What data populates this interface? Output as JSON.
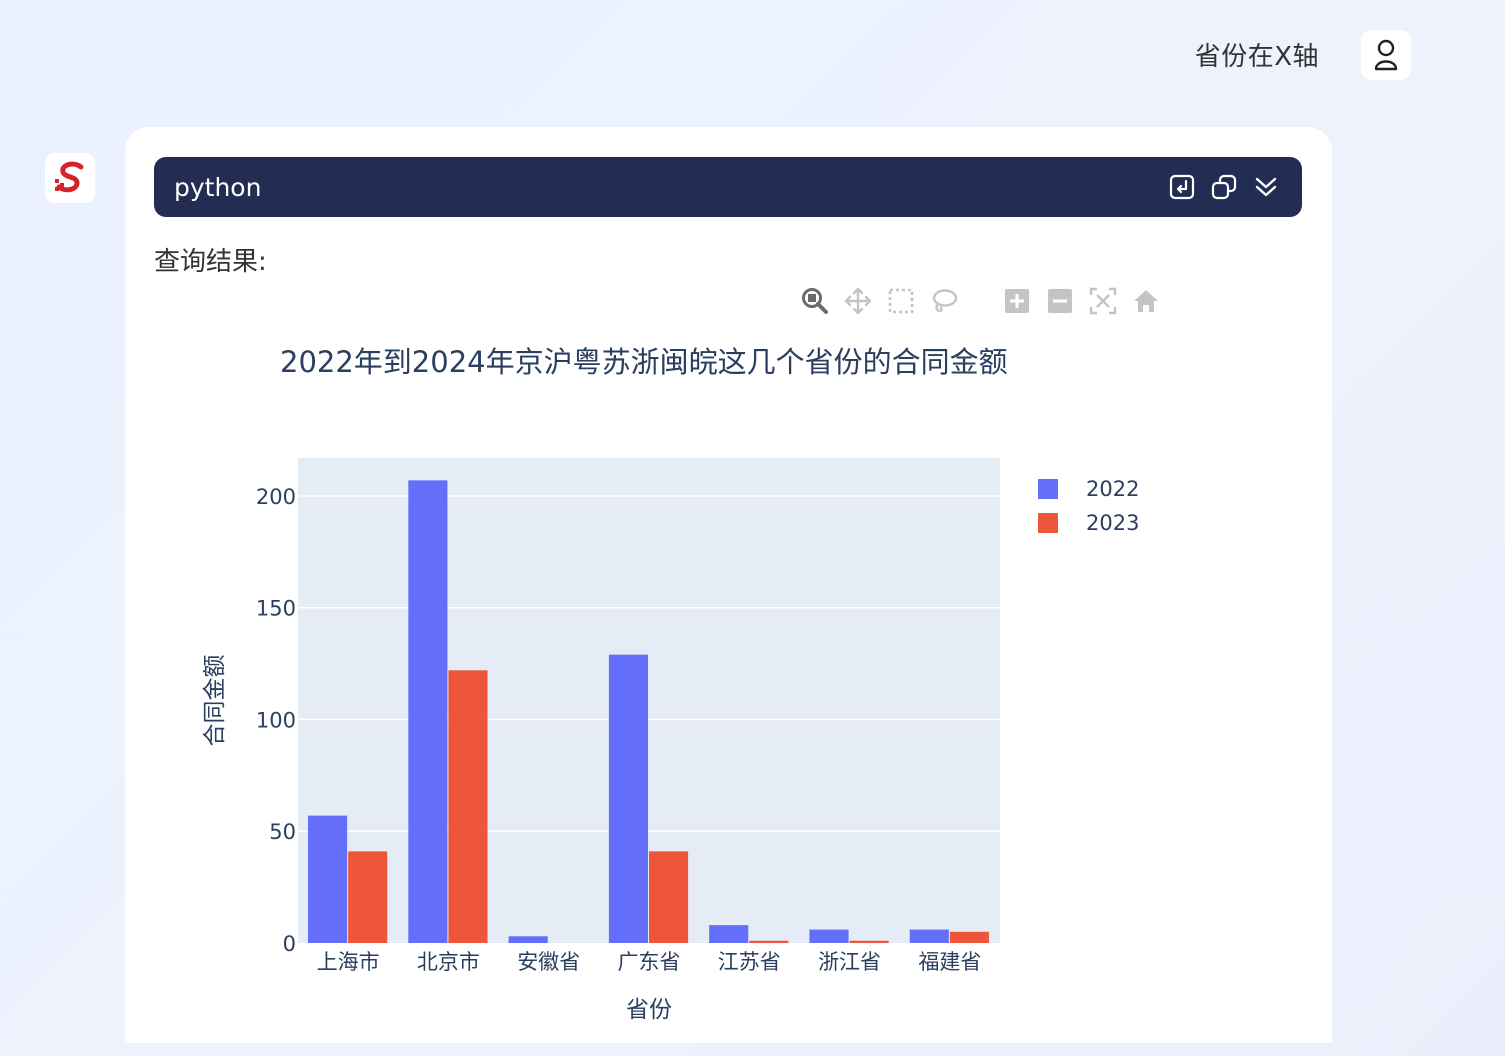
{
  "user_message": {
    "text": "省份在X轴"
  },
  "code_block": {
    "language": "python"
  },
  "result": {
    "label": "查询结果:"
  },
  "colors": {
    "series_2022": "#636efa",
    "series_2023": "#ef553b",
    "plot_bg": "#e5ecf6",
    "header_bg": "#232c52"
  },
  "chart_data": {
    "type": "bar",
    "title": "2022年到2024年京沪粤苏浙闽皖这几个省份的合同金额",
    "xlabel": "省份",
    "ylabel": "合同金额",
    "categories": [
      "上海市",
      "北京市",
      "安徽省",
      "广东省",
      "江苏省",
      "浙江省",
      "福建省"
    ],
    "series": [
      {
        "name": "2022",
        "values": [
          57,
          207,
          3,
          129,
          8,
          6,
          6
        ]
      },
      {
        "name": "2023",
        "values": [
          41,
          122,
          0,
          41,
          1,
          1,
          5
        ]
      }
    ],
    "ylim": [
      0,
      217
    ],
    "yticks": [
      0,
      50,
      100,
      150,
      200
    ],
    "grid": true,
    "legend_position": "top-right"
  }
}
